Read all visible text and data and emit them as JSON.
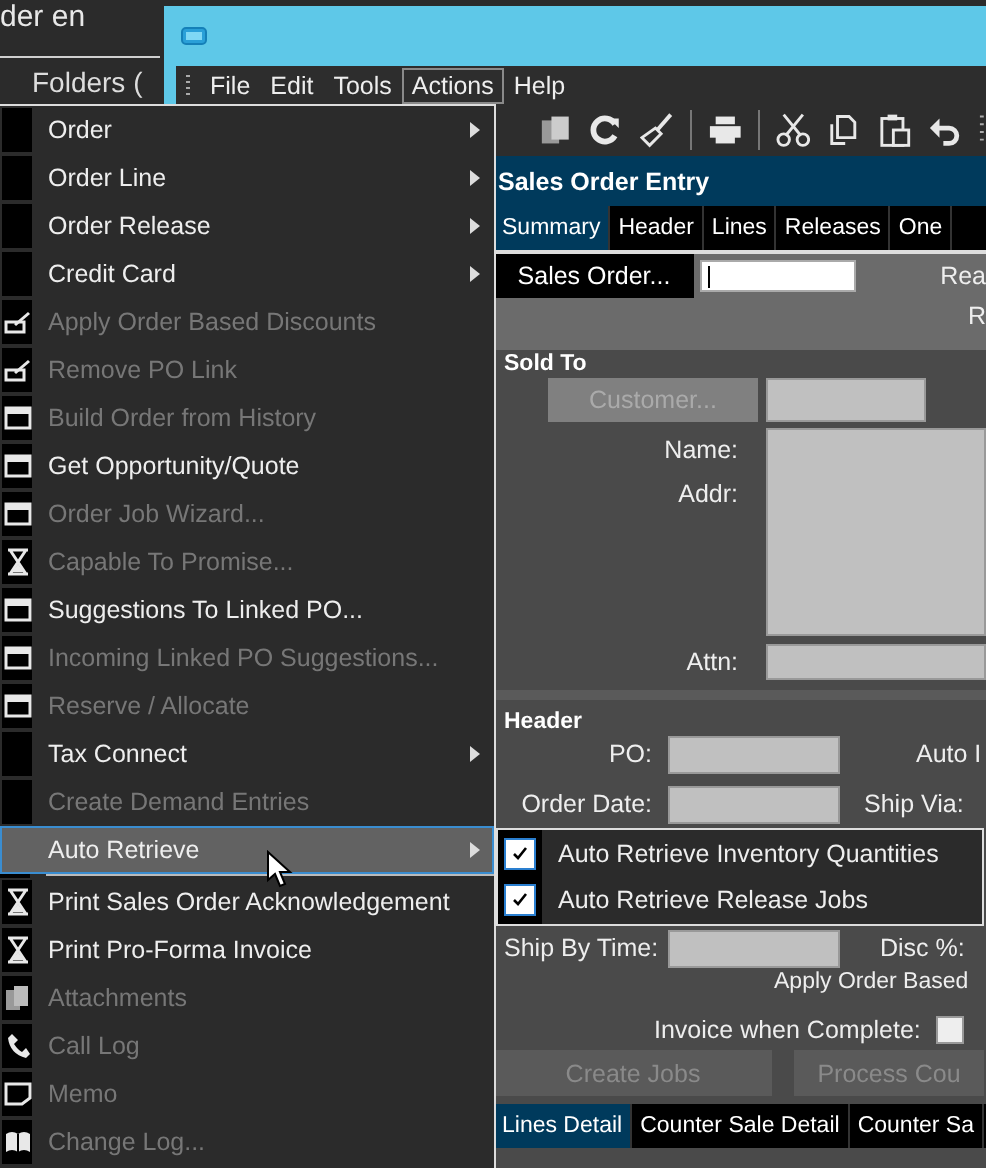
{
  "background": {
    "title": "der en",
    "folders": "Folders ("
  },
  "window": {
    "menubar": [
      {
        "label": "File",
        "selected": false
      },
      {
        "label": "Edit",
        "selected": false
      },
      {
        "label": "Tools",
        "selected": false
      },
      {
        "label": "Actions",
        "selected": true
      },
      {
        "label": "Help",
        "selected": false
      }
    ],
    "title": "Sales Order Entry",
    "tabs": [
      {
        "label": "Summary",
        "selected": true
      },
      {
        "label": "Header",
        "selected": false
      },
      {
        "label": "Lines",
        "selected": false
      },
      {
        "label": "Releases",
        "selected": false
      },
      {
        "label": "One",
        "selected": false
      }
    ],
    "sales_order_button": "Sales Order...",
    "cut_label_1": "Rea",
    "cut_label_2": "R",
    "sold_to": {
      "heading": "Sold To",
      "customer_button": {
        "label": "Customer...",
        "disabled": true
      },
      "name_label": "Name:",
      "addr_label": "Addr:",
      "attn_label": "Attn:"
    },
    "header": {
      "heading": "Header",
      "po_label": "PO:",
      "auto_label": "Auto I",
      "order_date_label": "Order Date:",
      "ship_via_label": "Ship Via:",
      "ship_by_time_label": "Ship By Time:",
      "disc_label": "Disc %:",
      "apply_label": "Apply Order Based",
      "invoice_label": "Invoice when Complete:",
      "invoice_checked": false
    },
    "buttons": [
      {
        "label": "Create Jobs",
        "disabled": true
      },
      {
        "label": "Process Cou",
        "disabled": true
      }
    ],
    "detail_tabs": [
      {
        "label": "Lines Detail",
        "selected": true
      },
      {
        "label": "Counter Sale Detail",
        "selected": false
      },
      {
        "label": "Counter Sa",
        "selected": false
      }
    ]
  },
  "actions_menu": {
    "items": [
      {
        "label": "Order",
        "kind": "submenu",
        "disabled": false,
        "selected": false
      },
      {
        "label": "Order Line",
        "kind": "submenu",
        "disabled": false,
        "selected": false
      },
      {
        "label": "Order Release",
        "kind": "submenu",
        "disabled": false,
        "selected": false
      },
      {
        "label": "Credit Card",
        "kind": "submenu",
        "disabled": false,
        "selected": false
      },
      {
        "label": "Apply Order Based Discounts",
        "kind": "edit",
        "disabled": true,
        "selected": false
      },
      {
        "label": "Remove PO Link",
        "kind": "edit",
        "disabled": true,
        "selected": false
      },
      {
        "label": "Build Order from History",
        "kind": "window",
        "disabled": true,
        "selected": false
      },
      {
        "label": "Get Opportunity/Quote",
        "kind": "window",
        "disabled": false,
        "selected": false
      },
      {
        "label": "Order Job Wizard...",
        "kind": "window",
        "disabled": true,
        "selected": false
      },
      {
        "label": "Capable To Promise...",
        "kind": "hourglass",
        "disabled": true,
        "selected": false
      },
      {
        "label": "Suggestions To Linked PO...",
        "kind": "window",
        "disabled": false,
        "selected": false
      },
      {
        "label": "Incoming Linked PO Suggestions...",
        "kind": "window",
        "disabled": true,
        "selected": false
      },
      {
        "label": "Reserve / Allocate",
        "kind": "window",
        "disabled": true,
        "selected": false
      },
      {
        "label": "Tax Connect",
        "kind": "submenu",
        "disabled": false,
        "selected": false
      },
      {
        "label": "Create Demand Entries",
        "kind": "plain",
        "disabled": true,
        "selected": false
      },
      {
        "label": "Auto Retrieve",
        "kind": "submenu",
        "disabled": false,
        "selected": true
      },
      {
        "kind": "separator"
      },
      {
        "label": "Print Sales Order Acknowledgement",
        "kind": "hourglass",
        "disabled": false,
        "selected": false
      },
      {
        "label": "Print Pro-Forma Invoice",
        "kind": "hourglass",
        "disabled": false,
        "selected": false
      },
      {
        "label": "Attachments",
        "kind": "documents",
        "disabled": true,
        "selected": false
      },
      {
        "label": "Call Log",
        "kind": "phone",
        "disabled": true,
        "selected": false
      },
      {
        "label": "Memo",
        "kind": "memo",
        "disabled": true,
        "selected": false
      },
      {
        "label": "Change Log...",
        "kind": "book",
        "disabled": true,
        "selected": false
      }
    ]
  },
  "submenu": {
    "items": [
      {
        "label": "Auto Retrieve Inventory Quantities",
        "checked": true
      },
      {
        "label": "Auto Retrieve Release Jobs",
        "checked": true
      }
    ]
  }
}
